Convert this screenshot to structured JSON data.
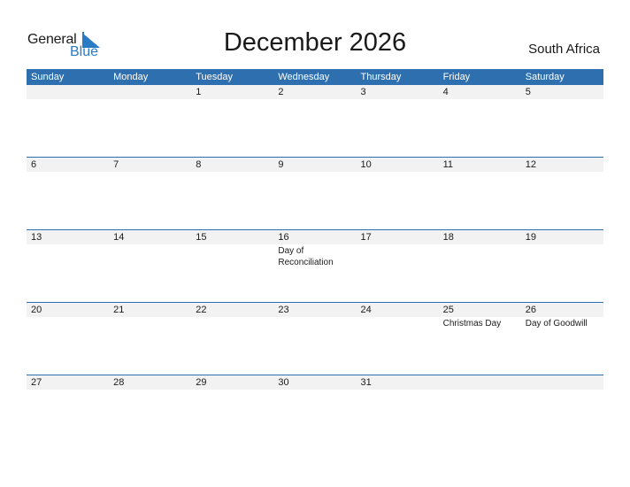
{
  "logo": {
    "general": "General",
    "blue": "Blue"
  },
  "title": "December 2026",
  "country": "South Africa",
  "weekdays": [
    "Sunday",
    "Monday",
    "Tuesday",
    "Wednesday",
    "Thursday",
    "Friday",
    "Saturday"
  ],
  "weeks": [
    [
      {
        "d": ""
      },
      {
        "d": ""
      },
      {
        "d": "1"
      },
      {
        "d": "2"
      },
      {
        "d": "3"
      },
      {
        "d": "4"
      },
      {
        "d": "5"
      }
    ],
    [
      {
        "d": "6"
      },
      {
        "d": "7"
      },
      {
        "d": "8"
      },
      {
        "d": "9"
      },
      {
        "d": "10"
      },
      {
        "d": "11"
      },
      {
        "d": "12"
      }
    ],
    [
      {
        "d": "13"
      },
      {
        "d": "14"
      },
      {
        "d": "15"
      },
      {
        "d": "16",
        "h": "Day of Reconciliation"
      },
      {
        "d": "17"
      },
      {
        "d": "18"
      },
      {
        "d": "19"
      }
    ],
    [
      {
        "d": "20"
      },
      {
        "d": "21"
      },
      {
        "d": "22"
      },
      {
        "d": "23"
      },
      {
        "d": "24"
      },
      {
        "d": "25",
        "h": "Christmas Day"
      },
      {
        "d": "26",
        "h": "Day of Goodwill"
      }
    ],
    [
      {
        "d": "27"
      },
      {
        "d": "28"
      },
      {
        "d": "29"
      },
      {
        "d": "30"
      },
      {
        "d": "31"
      },
      {
        "d": ""
      },
      {
        "d": ""
      }
    ]
  ],
  "colors": {
    "header": "#2e6fb0",
    "row_shade": "#f2f2f2",
    "logo_blue": "#2a7bc6"
  }
}
